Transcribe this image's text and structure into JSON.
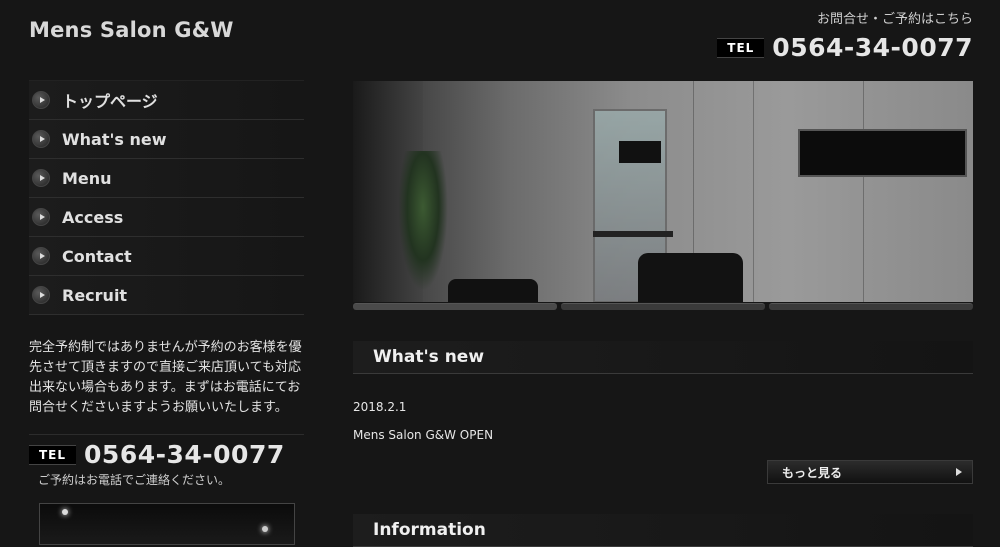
{
  "header": {
    "site_title": "Mens Salon G&W",
    "contact_note": "お問合せ・ご予約はこちら",
    "tel_badge": "TEL",
    "tel_number": "0564-34-0077"
  },
  "nav": {
    "items": [
      {
        "label": "トップページ"
      },
      {
        "label": "What's new"
      },
      {
        "label": "Menu"
      },
      {
        "label": "Access"
      },
      {
        "label": "Contact"
      },
      {
        "label": "Recruit"
      }
    ]
  },
  "sidebar": {
    "notice": "完全予約制ではありませんが予約のお客様を優先させて頂きますので直接ご来店頂いても対応出来ない場合もあります。まずはお電話にてお問合せくださいますようお願いいたします。",
    "tel_badge": "TEL",
    "tel_number": "0564-34-0077",
    "tel_note": "ご予約はお電話でご連絡ください。"
  },
  "main": {
    "whats_new": {
      "title": "What's new",
      "date": "2018.2.1",
      "text": "Mens Salon G&W OPEN",
      "more_label": "もっと見る"
    },
    "information": {
      "title": "Information"
    }
  },
  "icons": {
    "nav_bullet": "play-circle-icon",
    "more_arrow": "triangle-right-icon"
  }
}
